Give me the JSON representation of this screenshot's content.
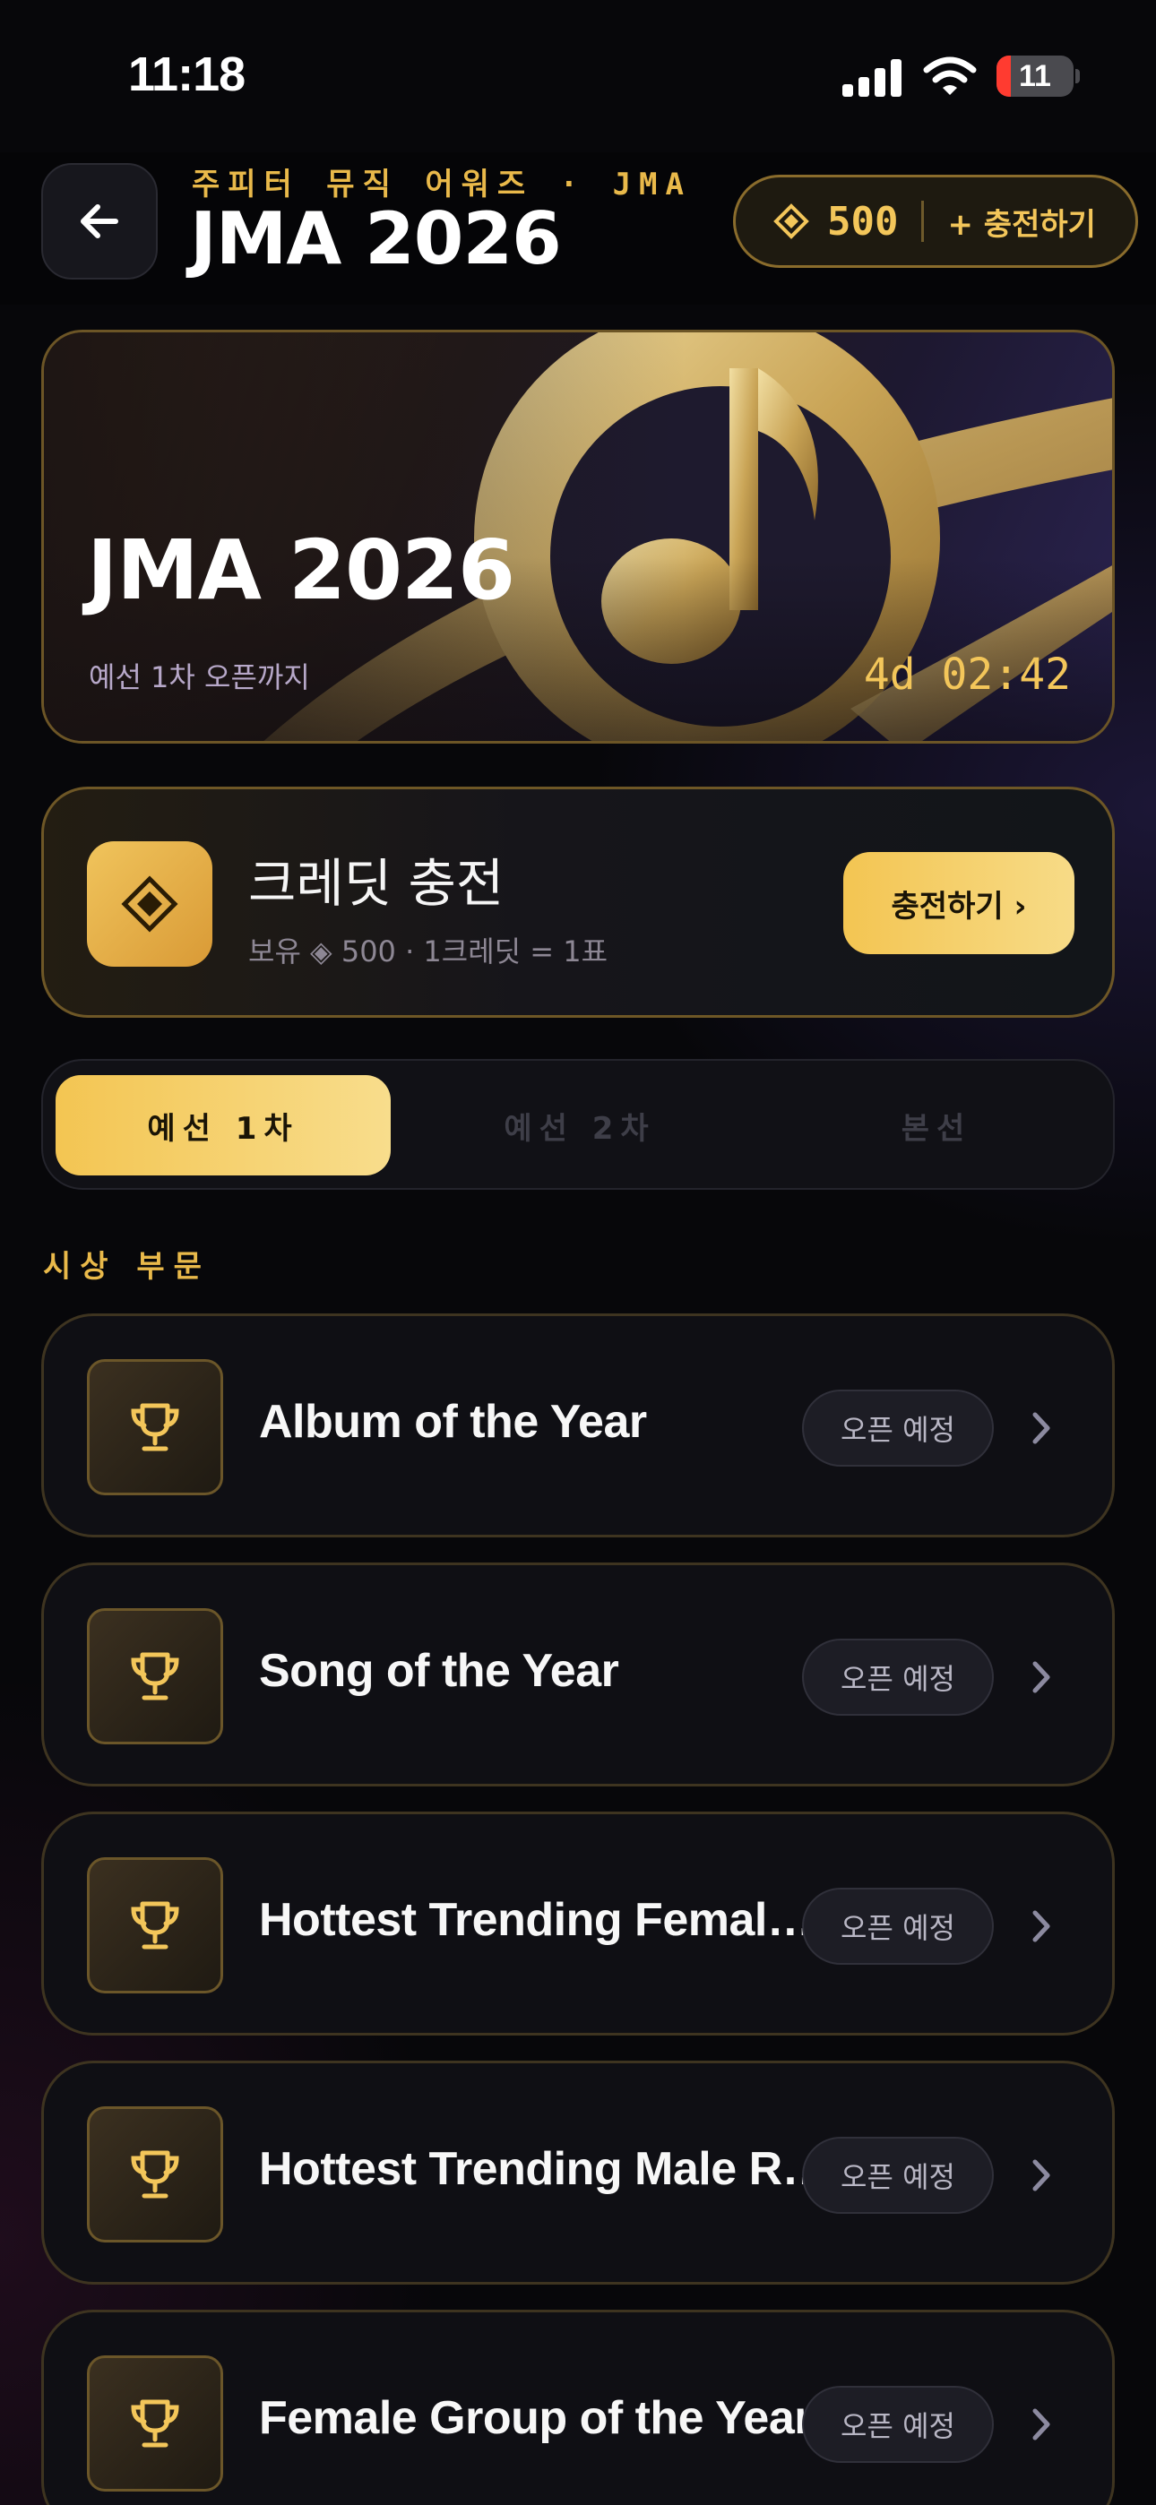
{
  "status_bar": {
    "time": "11:18",
    "battery": "11"
  },
  "header": {
    "subtitle": "주피터 뮤직 어워즈 · JMA",
    "title": "JMA 2026",
    "credit_amount": "500",
    "charge_label": "+ 충전하기"
  },
  "hero": {
    "title": "JMA 2026",
    "caption": "예선 1차 오픈까지",
    "countdown": "4d 02:42"
  },
  "credit_card": {
    "title": "크레딧 충전",
    "subtitle": "보유 ◈ 500 · 1크레딧 = 1표",
    "button": "충전하기 ›"
  },
  "tabs": [
    {
      "label": "예선 1차",
      "active": true
    },
    {
      "label": "예선 2차",
      "active": false
    },
    {
      "label": "본선",
      "active": false
    }
  ],
  "section_label": "시상 부문",
  "categories": [
    {
      "name": "Album of the Year",
      "status": "오픈 예정"
    },
    {
      "name": "Song of the Year",
      "status": "오픈 예정"
    },
    {
      "name": "Hottest Trending Female Rookie",
      "status": "오픈 예정"
    },
    {
      "name": "Hottest Trending Male Rookie",
      "status": "오픈 예정"
    },
    {
      "name": "Female Group of the Year",
      "status": "오픈 예정"
    }
  ],
  "icons": {
    "back": "arrow-left-icon",
    "credit": "diamond-icon",
    "category": "trophy-icon",
    "chevron": "chevron-right-icon"
  },
  "colors": {
    "accent": "#F3C552",
    "background": "#07070A"
  }
}
